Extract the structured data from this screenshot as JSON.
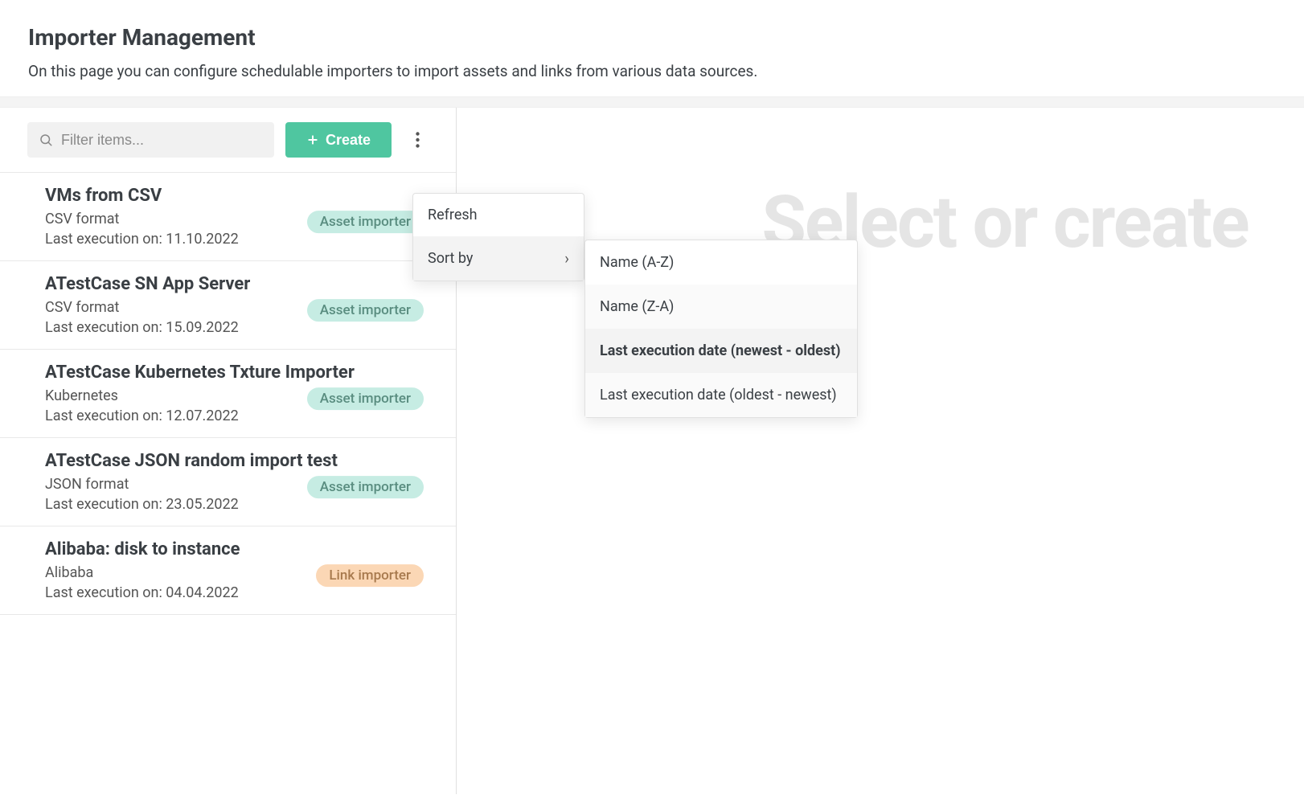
{
  "header": {
    "title": "Importer Management",
    "description": "On this page you can configure schedulable importers to import assets and links from various data sources."
  },
  "toolbar": {
    "filter_placeholder": "Filter items...",
    "create_label": "Create"
  },
  "menu": {
    "refresh": "Refresh",
    "sort_by": "Sort by",
    "sort_options": [
      "Name (A-Z)",
      "Name (Z-A)",
      "Last execution date (newest - oldest)",
      "Last execution date (oldest - newest)"
    ],
    "sort_active_index": 2
  },
  "badges": {
    "asset": "Asset importer",
    "link": "Link importer"
  },
  "exec_prefix": "Last execution on: ",
  "importers": [
    {
      "name": "VMs from CSV",
      "source": "CSV format",
      "last_exec": "11.10.2022",
      "type": "asset"
    },
    {
      "name": "ATestCase SN App Server",
      "source": "CSV format",
      "last_exec": "15.09.2022",
      "type": "asset"
    },
    {
      "name": "ATestCase Kubernetes Txture Importer",
      "source": "Kubernetes",
      "last_exec": "12.07.2022",
      "type": "asset"
    },
    {
      "name": "ATestCase JSON random import test",
      "source": "JSON format",
      "last_exec": "23.05.2022",
      "type": "asset"
    },
    {
      "name": "Alibaba: disk to instance",
      "source": "Alibaba",
      "last_exec": "04.04.2022",
      "type": "link"
    }
  ],
  "placeholder": "Select or create"
}
